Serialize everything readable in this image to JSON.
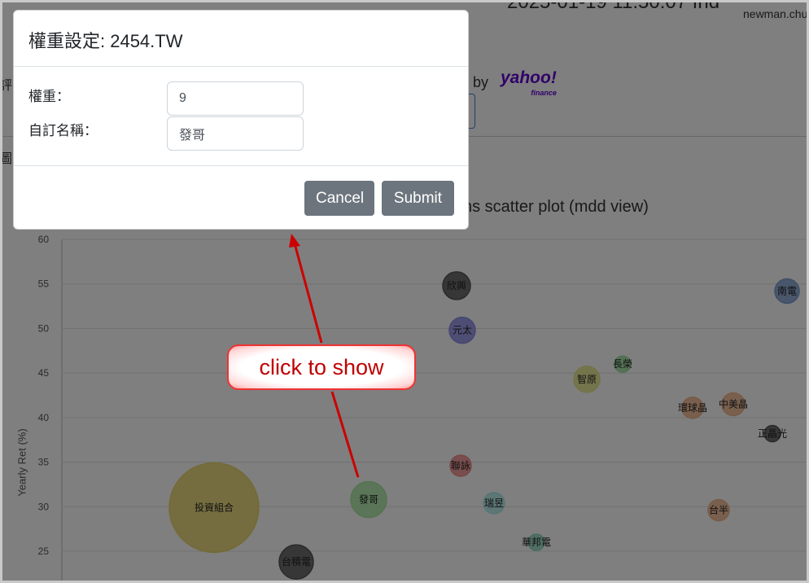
{
  "background": {
    "datetime": "2025-01-19 11:50:07 fhd",
    "user": "newman.chu",
    "by_label": "by",
    "brand": "yahoo!",
    "brand_sub": "finance",
    "left_text_1": "評",
    "left_text_2": "圖",
    "chart_title_fragment": "ns scatter plot (mdd view)"
  },
  "modal": {
    "title": "權重設定: 2454.TW",
    "weight_label": "權重：",
    "weight_value": "9",
    "name_label": "自訂名稱：",
    "name_value": "發哥",
    "cancel_label": "Cancel",
    "submit_label": "Submit"
  },
  "annotation": {
    "text": "click to show"
  },
  "chart_data": {
    "type": "scatter",
    "title": "ns scatter plot (mdd view)",
    "ylabel": "Yearly Ret (%)",
    "ylim": [
      22,
      60
    ],
    "yticks": [
      25,
      30,
      35,
      40,
      45,
      50,
      55,
      60
    ],
    "points": [
      {
        "label": "欣興",
        "y": 54.8,
        "color": "#555555",
        "r": 17
      },
      {
        "label": "南電",
        "y": 54.2,
        "color": "#7f9fd0",
        "r": 15
      },
      {
        "label": "元太",
        "y": 49.8,
        "color": "#8c8ce6",
        "r": 16
      },
      {
        "label": "長榮",
        "y": 46.0,
        "color": "#9ee09e",
        "r": 10
      },
      {
        "label": "智原",
        "y": 44.3,
        "color": "#e6e68a",
        "r": 16
      },
      {
        "label": "環球晶",
        "y": 41.1,
        "color": "#f0b58c",
        "r": 13
      },
      {
        "label": "中美晶",
        "y": 41.5,
        "color": "#f0b58c",
        "r": 14
      },
      {
        "label": "正晶光",
        "y": 38.2,
        "color": "#555555",
        "r": 10
      },
      {
        "label": "聯詠",
        "y": 34.6,
        "color": "#f08c8c",
        "r": 13
      },
      {
        "label": "瑞昱",
        "y": 30.4,
        "color": "#aeeaea",
        "r": 13
      },
      {
        "label": "發哥",
        "y": 30.8,
        "color": "#a8e6a0",
        "r": 22
      },
      {
        "label": "投資組合",
        "y": 29.9,
        "color": "#e6d46a",
        "r": 55
      },
      {
        "label": "台半",
        "y": 29.6,
        "color": "#f0b58c",
        "r": 13
      },
      {
        "label": "華邦電",
        "y": 26.0,
        "color": "#8fd6c0",
        "r": 10
      },
      {
        "label": "台積電",
        "y": 23.8,
        "color": "#555555",
        "r": 21
      }
    ]
  }
}
